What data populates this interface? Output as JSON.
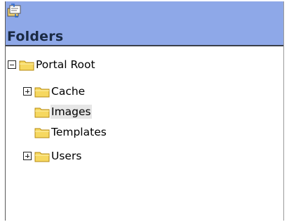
{
  "header": {
    "title": "Folders",
    "icon": "folder-sync-icon"
  },
  "tree": {
    "root": {
      "label": "Portal Root",
      "expanded": true,
      "toggle": "minus"
    },
    "children": [
      {
        "label": "Cache",
        "toggle": "plus",
        "selected": false
      },
      {
        "label": "Images",
        "toggle": "none",
        "selected": true
      },
      {
        "label": "Templates",
        "toggle": "none",
        "selected": false
      },
      {
        "label": "Users",
        "toggle": "plus",
        "selected": false
      }
    ]
  },
  "colors": {
    "header_bg": "#8ea8e8",
    "folder_fill": "#f6d860",
    "folder_stroke": "#b68a10",
    "selected_bg": "#e6e6e6"
  }
}
